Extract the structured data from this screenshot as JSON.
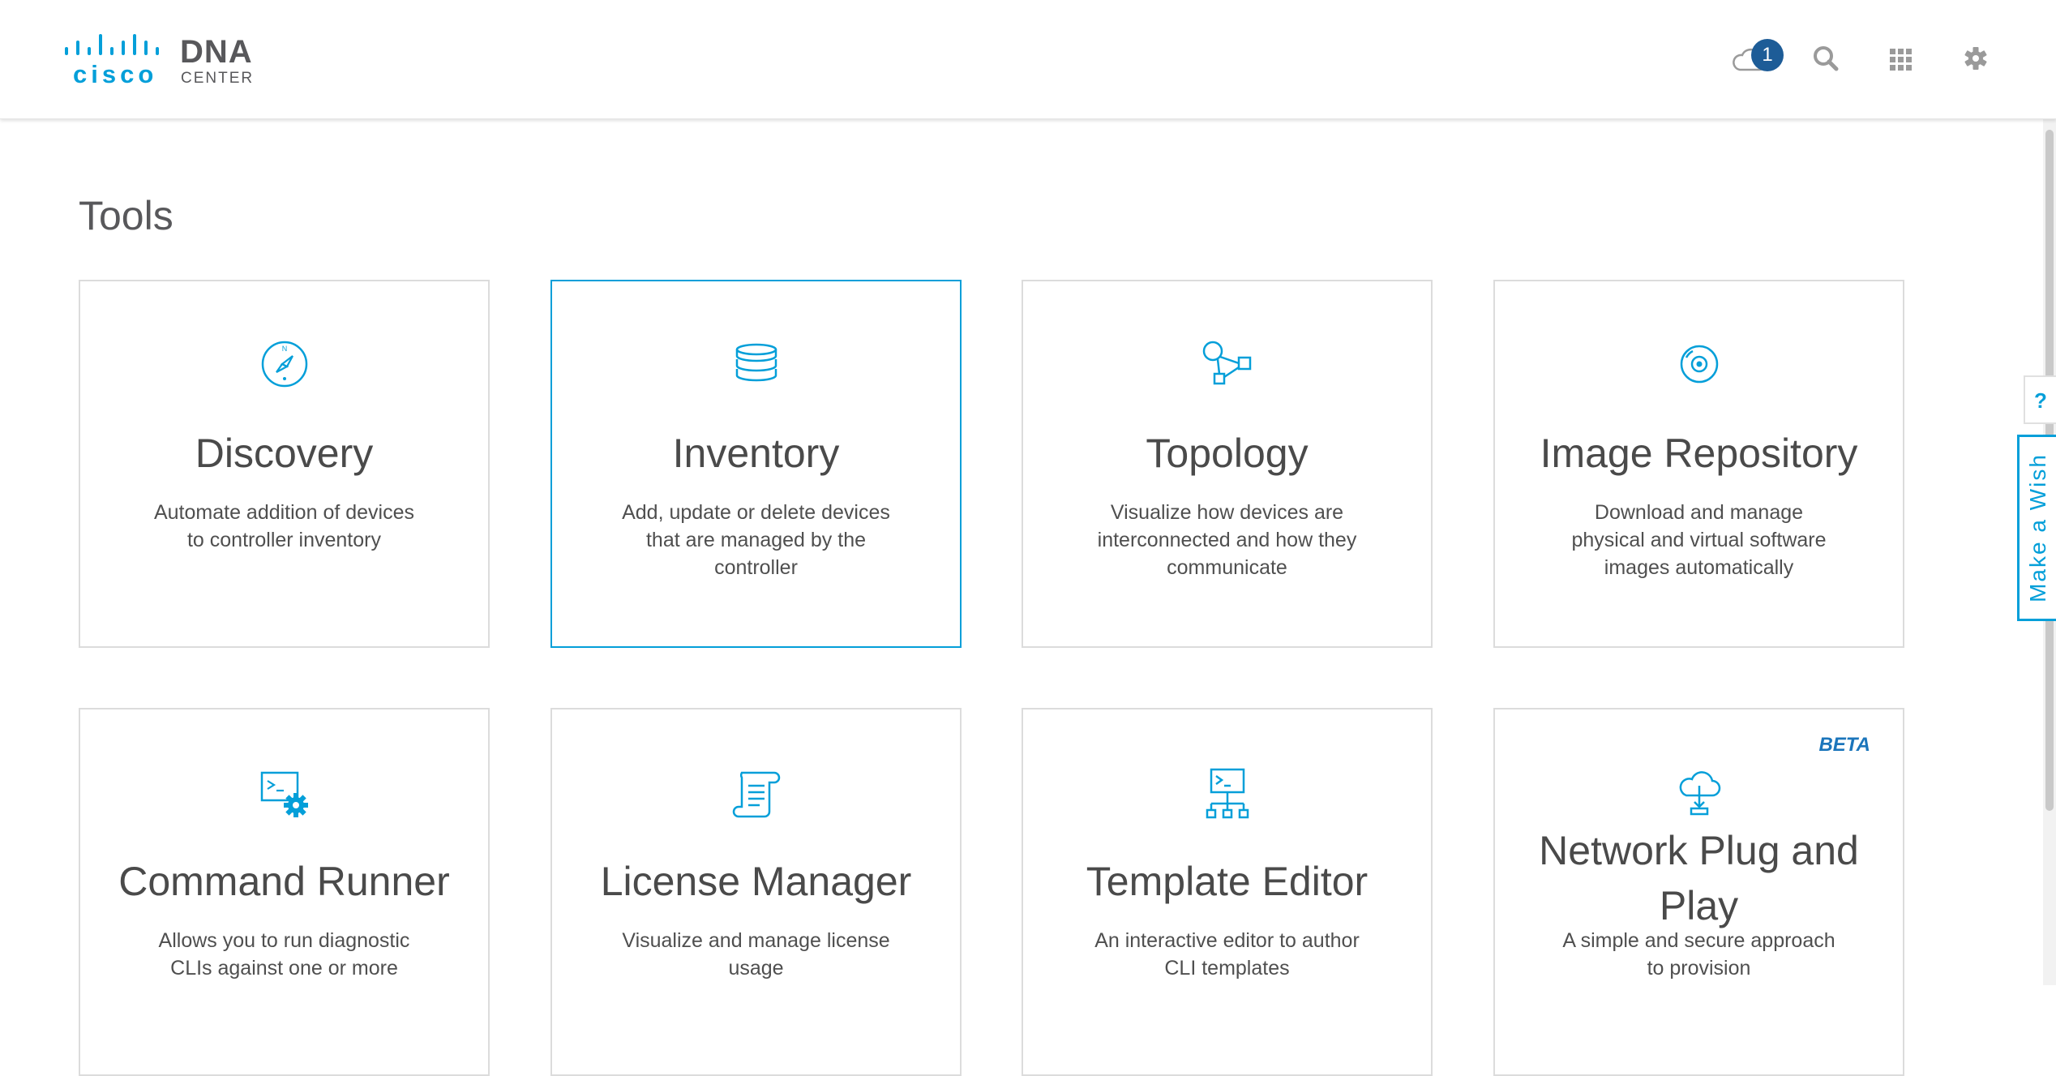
{
  "brand": {
    "logo_text": "cisco",
    "product": "DNA",
    "product_sub": "CENTER"
  },
  "header": {
    "notification_count": "1",
    "icons": [
      "cloud-icon",
      "search-icon",
      "apps-grid-icon",
      "gear-icon"
    ]
  },
  "page": {
    "title": "Tools"
  },
  "cards": [
    {
      "title": "Discovery",
      "desc": "Automate addition of devices to controller inventory",
      "icon": "compass-icon"
    },
    {
      "title": "Inventory",
      "desc": "Add, update or delete devices that are managed by the controller",
      "icon": "database-icon"
    },
    {
      "title": "Topology",
      "desc": "Visualize how devices are interconnected and how they communicate",
      "icon": "topology-icon"
    },
    {
      "title": "Image Repository",
      "desc": "Download and manage physical and virtual software images automatically",
      "icon": "disc-icon"
    },
    {
      "title": "Command Runner",
      "desc": "Allows you to run diagnostic CLIs against one or more",
      "icon": "terminal-gear-icon"
    },
    {
      "title": "License Manager",
      "desc": "Visualize and manage license usage",
      "icon": "scroll-icon"
    },
    {
      "title": "Template Editor",
      "desc": "An interactive editor to author CLI templates",
      "icon": "terminal-tree-icon"
    },
    {
      "title": "Network Plug and Play",
      "desc": "A simple and secure approach to provision",
      "badge": "BETA",
      "icon": "cloud-download-icon"
    }
  ],
  "side": {
    "help_label": "?",
    "wish_label": "Make a Wish"
  },
  "colors": {
    "accent": "#049fd9",
    "badge": "#1d5c97",
    "beta": "#1b75bb"
  }
}
